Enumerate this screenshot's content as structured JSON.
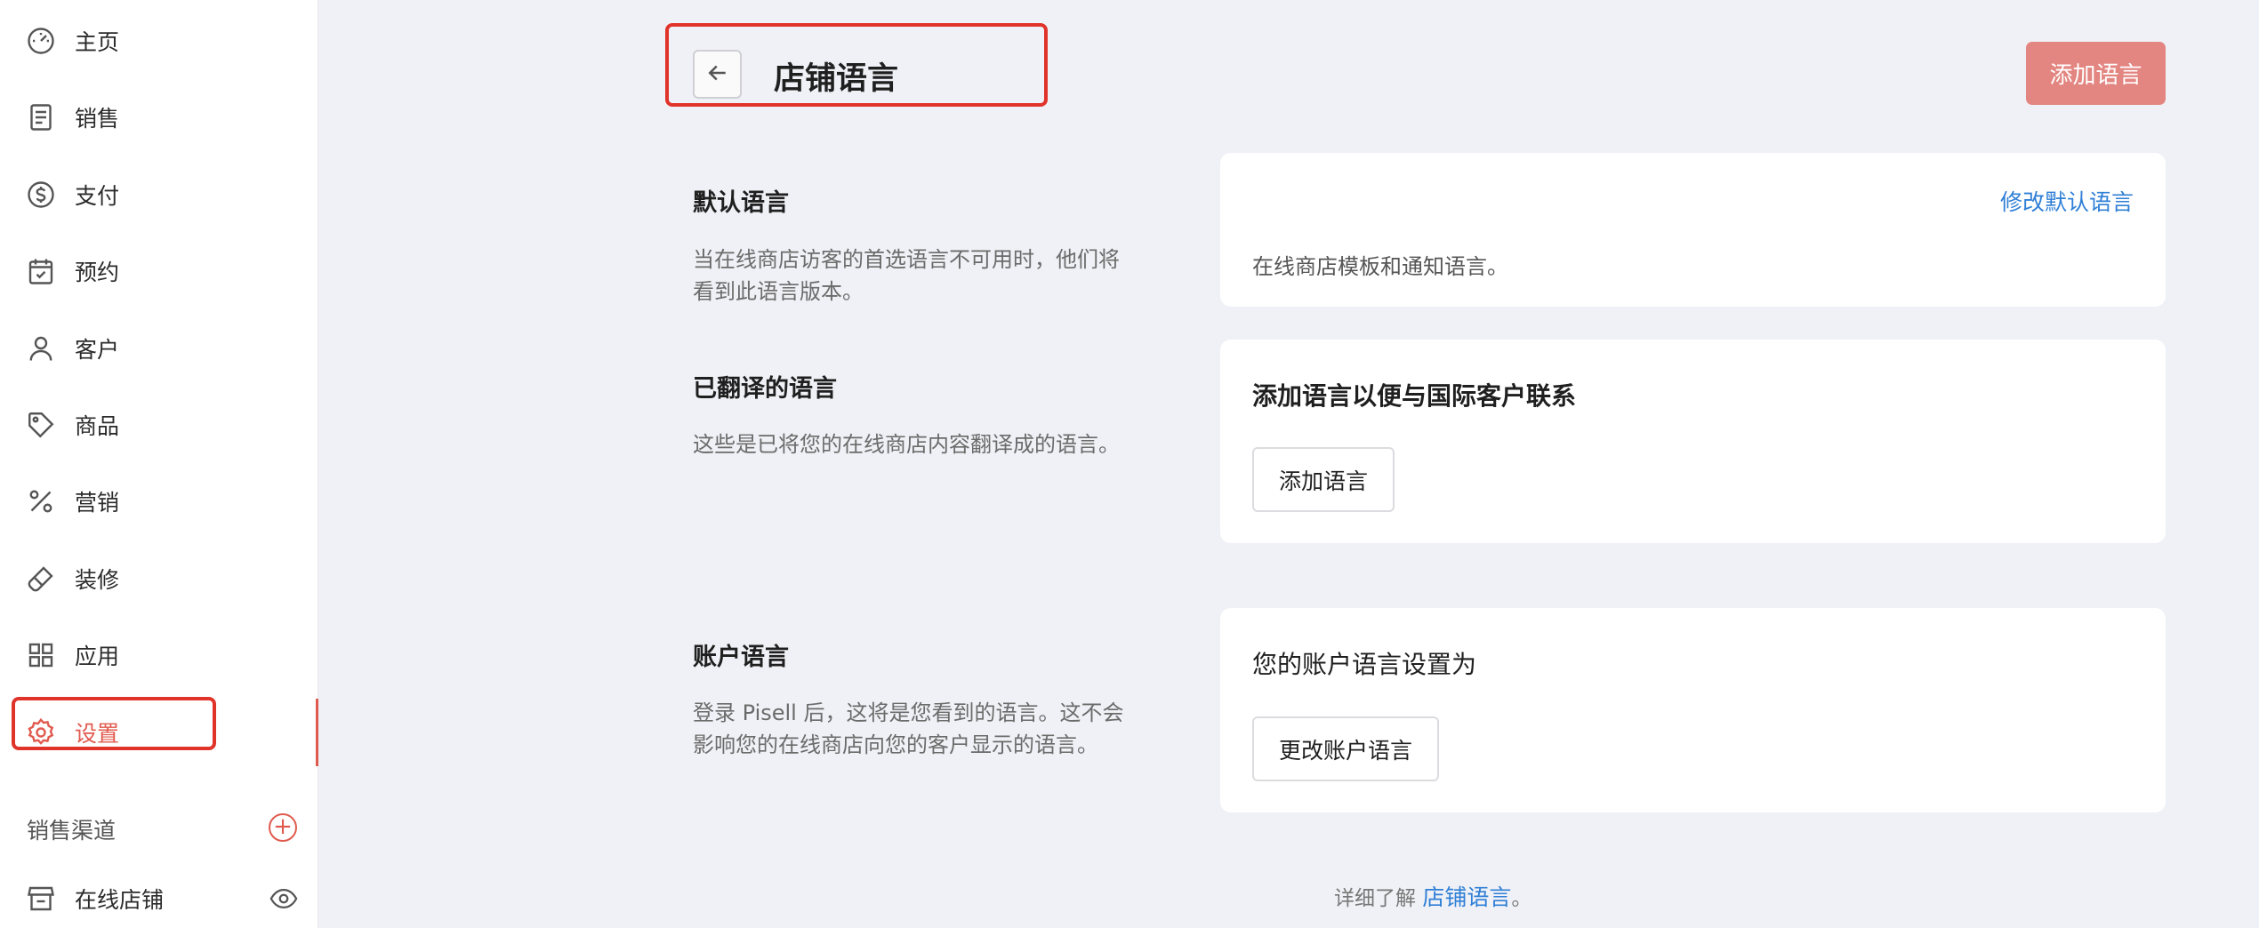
{
  "sidebar": {
    "items": [
      {
        "label": "主页",
        "icon": "dashboard-icon"
      },
      {
        "label": "销售",
        "icon": "receipt-icon"
      },
      {
        "label": "支付",
        "icon": "dollar-icon"
      },
      {
        "label": "预约",
        "icon": "calendar-check-icon"
      },
      {
        "label": "客户",
        "icon": "user-icon"
      },
      {
        "label": "商品",
        "icon": "tag-icon"
      },
      {
        "label": "营销",
        "icon": "percent-icon"
      },
      {
        "label": "装修",
        "icon": "brush-icon"
      },
      {
        "label": "应用",
        "icon": "grid-icon"
      },
      {
        "label": "设置",
        "icon": "gear-icon",
        "active": true
      }
    ],
    "channels_title": "销售渠道",
    "online_store": "在线店铺"
  },
  "header": {
    "title": "店铺语言",
    "add_language_button": "添加语言"
  },
  "sections": {
    "default": {
      "heading": "默认语言",
      "desc": "当在线商店访客的首选语言不可用时，他们将 看到此语言版本。",
      "link": "修改默认语言",
      "card_text": "在线商店模板和通知语言。"
    },
    "translated": {
      "heading": "已翻译的语言",
      "desc": "这些是已将您的在线商店内容翻译成的语言。",
      "card_heading": "添加语言以便与国际客户联系",
      "button": "添加语言"
    },
    "account": {
      "heading": "账户语言",
      "desc": "登录 Pisell 后，这将是您看到的语言。这不会影响您的在线商店向您的客户显示的语言。",
      "card_text": "您的账户语言设置为",
      "button": "更改账户语言"
    }
  },
  "footer": {
    "prefix": "详细了解",
    "link": "店铺语言",
    "suffix": "。"
  },
  "colors": {
    "accent": "#e05a4e",
    "highlight": "#e0332a",
    "primary_button": "#e38580",
    "link": "#2f7fd6",
    "background": "#f0f1f6"
  }
}
